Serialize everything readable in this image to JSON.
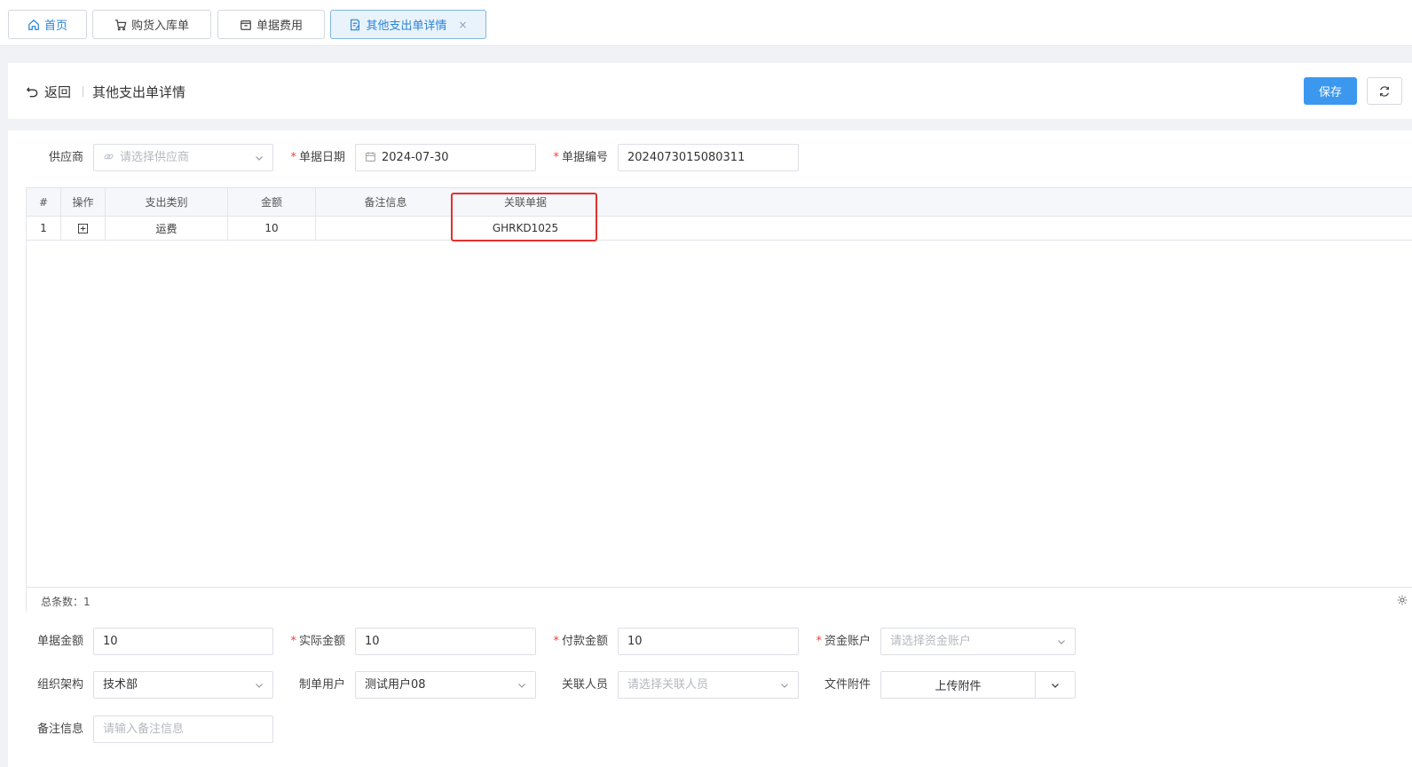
{
  "tabs": [
    {
      "label": "首页",
      "icon": "home-icon"
    },
    {
      "label": "购货入库单",
      "icon": "cart-icon"
    },
    {
      "label": "单据费用",
      "icon": "receipt-icon"
    },
    {
      "label": "其他支出单详情",
      "icon": "document-edit-icon",
      "active": true,
      "close": "×"
    }
  ],
  "header": {
    "back_label": "返回",
    "title": "其他支出单详情",
    "save_label": "保存"
  },
  "form_top": {
    "supplier_label": "供应商",
    "supplier_placeholder": "请选择供应商",
    "date_label": "单据日期",
    "date_value": "2024-07-30",
    "number_label": "单据编号",
    "number_value": "2024073015080311"
  },
  "table": {
    "columns": [
      "#",
      "操作",
      "支出类别",
      "金额",
      "备注信息",
      "关联单据"
    ],
    "rows": [
      {
        "index": "1",
        "category": "运费",
        "amount": "10",
        "remark": "",
        "related": "GHRKD1025"
      }
    ],
    "total_label": "总条数：1"
  },
  "form_bottom": {
    "doc_amount_label": "单据金额",
    "doc_amount_value": "10",
    "actual_amount_label": "实际金额",
    "actual_amount_value": "10",
    "pay_amount_label": "付款金额",
    "pay_amount_value": "10",
    "account_label": "资金账户",
    "account_placeholder": "请选择资金账户",
    "org_label": "组织架构",
    "org_value": "技术部",
    "creator_label": "制单用户",
    "creator_value": "测试用户08",
    "related_person_label": "关联人员",
    "related_person_placeholder": "请选择关联人员",
    "attachment_label": "文件附件",
    "upload_label": "上传附件",
    "remark_label": "备注信息",
    "remark_placeholder": "请输入备注信息"
  },
  "colors": {
    "primary": "#3c98ee",
    "active_tab_bg": "#e9f3fc",
    "highlight_border": "#e5302f",
    "required_star": "#e4463b"
  }
}
